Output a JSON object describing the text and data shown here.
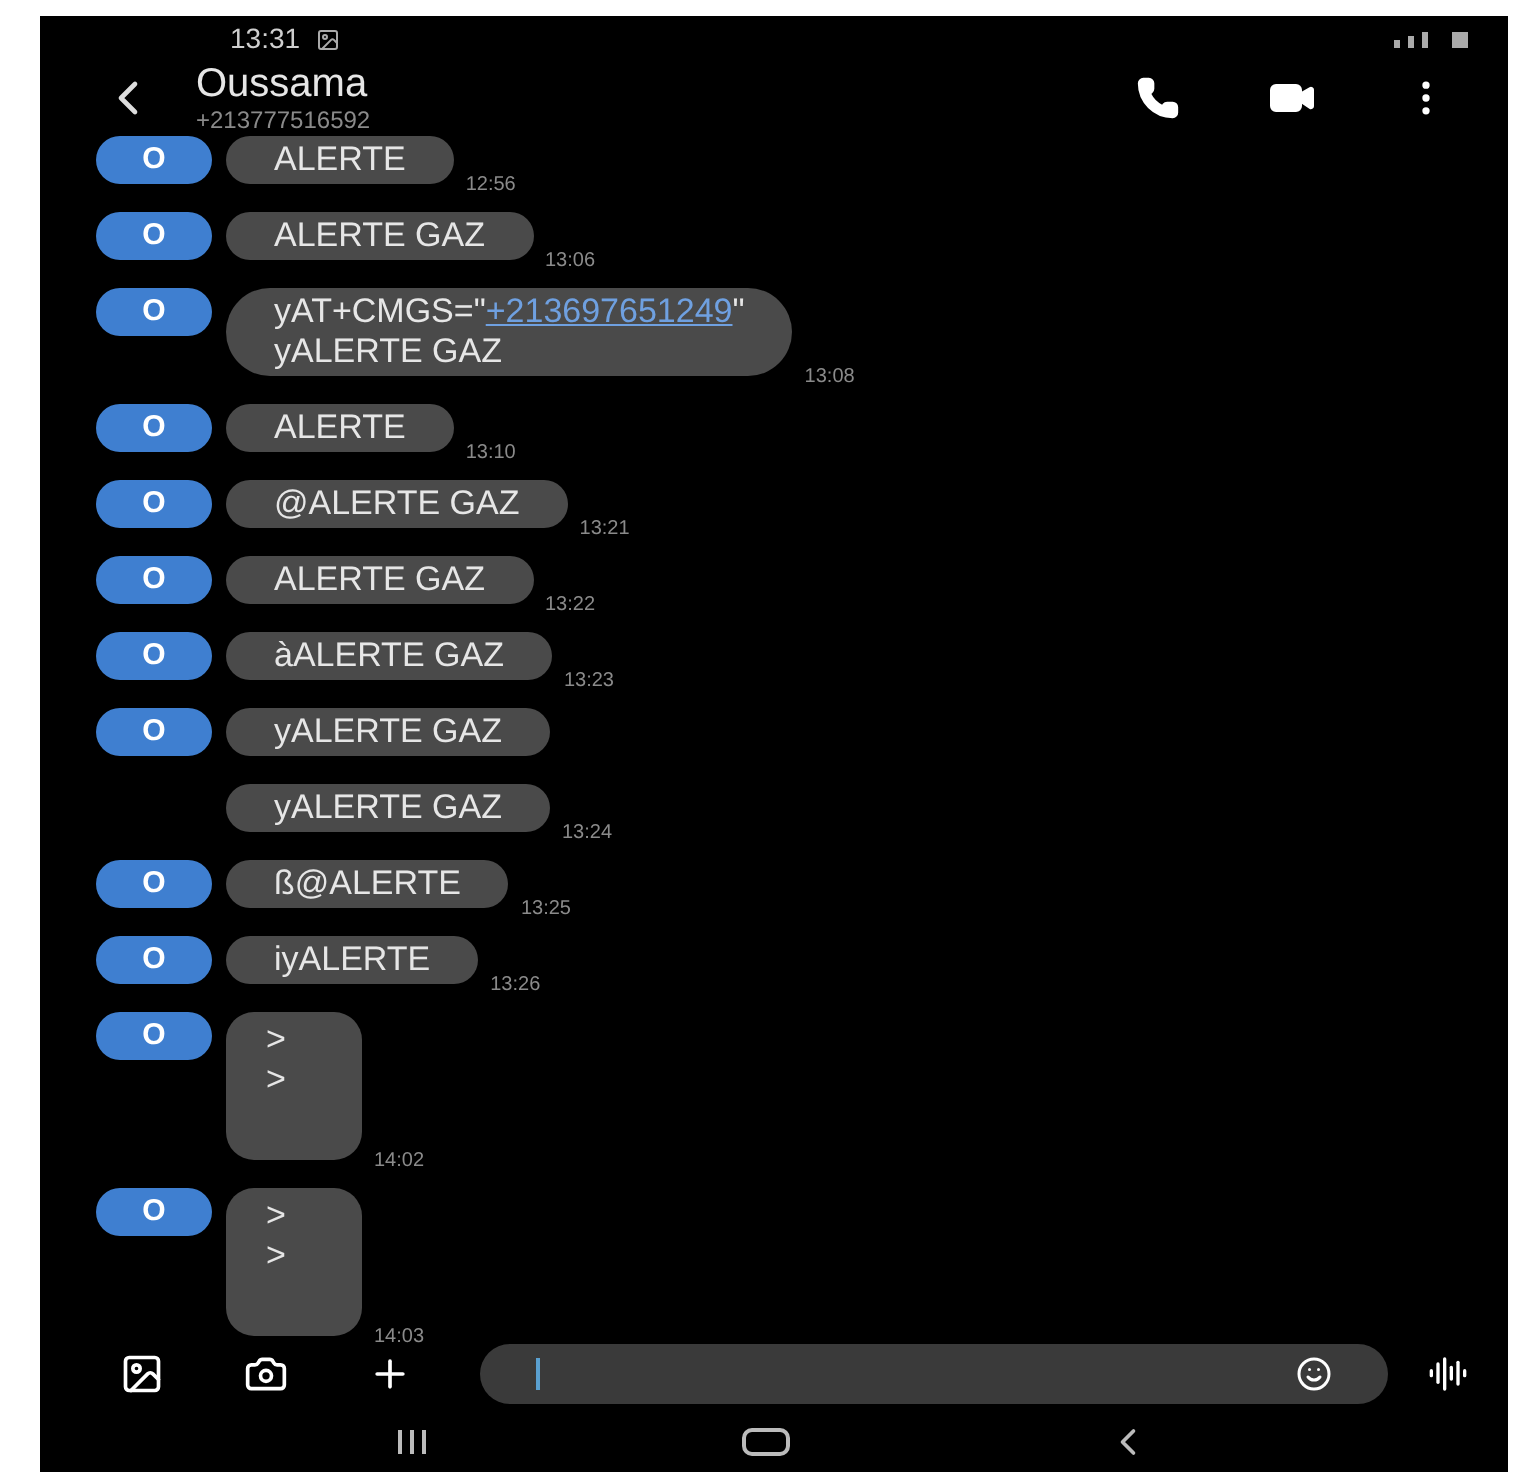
{
  "status_bar": {
    "time": "13:31"
  },
  "header": {
    "name": "Oussama",
    "number": "+213777516592"
  },
  "messages": [
    {
      "avatar": "O",
      "lines": [
        [
          {
            "text": "ALERTE"
          }
        ]
      ],
      "time": "12:56"
    },
    {
      "avatar": "O",
      "lines": [
        [
          {
            "text": "ALERTE GAZ"
          }
        ]
      ],
      "time": "13:06"
    },
    {
      "avatar": "O",
      "lines": [
        [
          {
            "text": "yAT+CMGS=\""
          },
          {
            "text": "+213697651249",
            "kind": "link"
          },
          {
            "text": "\""
          }
        ],
        [
          {
            "text": "yALERTE GAZ"
          }
        ]
      ],
      "time": "13:08"
    },
    {
      "avatar": "O",
      "lines": [
        [
          {
            "text": "ALERTE"
          }
        ]
      ],
      "time": "13:10"
    },
    {
      "avatar": "O",
      "lines": [
        [
          {
            "text": "@ALERTE GAZ"
          }
        ]
      ],
      "time": "13:21"
    },
    {
      "avatar": "O",
      "lines": [
        [
          {
            "text": "ALERTE GAZ"
          }
        ]
      ],
      "time": "13:22"
    },
    {
      "avatar": "O",
      "lines": [
        [
          {
            "text": "àALERTE GAZ"
          }
        ]
      ],
      "time": "13:23"
    },
    {
      "avatar": "O",
      "lines": [
        [
          {
            "text": "yALERTE GAZ"
          }
        ]
      ]
    },
    {
      "lines": [
        [
          {
            "text": "yALERTE GAZ"
          }
        ]
      ],
      "time": "13:24"
    },
    {
      "avatar": "O",
      "lines": [
        [
          {
            "text": "ß@ALERTE"
          }
        ]
      ],
      "time": "13:25"
    },
    {
      "avatar": "O",
      "lines": [
        [
          {
            "text": "iyALERTE"
          }
        ]
      ],
      "time": "13:26"
    },
    {
      "avatar": "O",
      "lines": [
        [
          {
            "text": ">"
          }
        ],
        [
          {
            "text": ">"
          }
        ]
      ],
      "time": "14:02"
    },
    {
      "avatar": "O",
      "lines": [
        [
          {
            "text": ">"
          }
        ],
        [
          {
            "text": ">"
          }
        ]
      ],
      "time": "14:03"
    }
  ]
}
